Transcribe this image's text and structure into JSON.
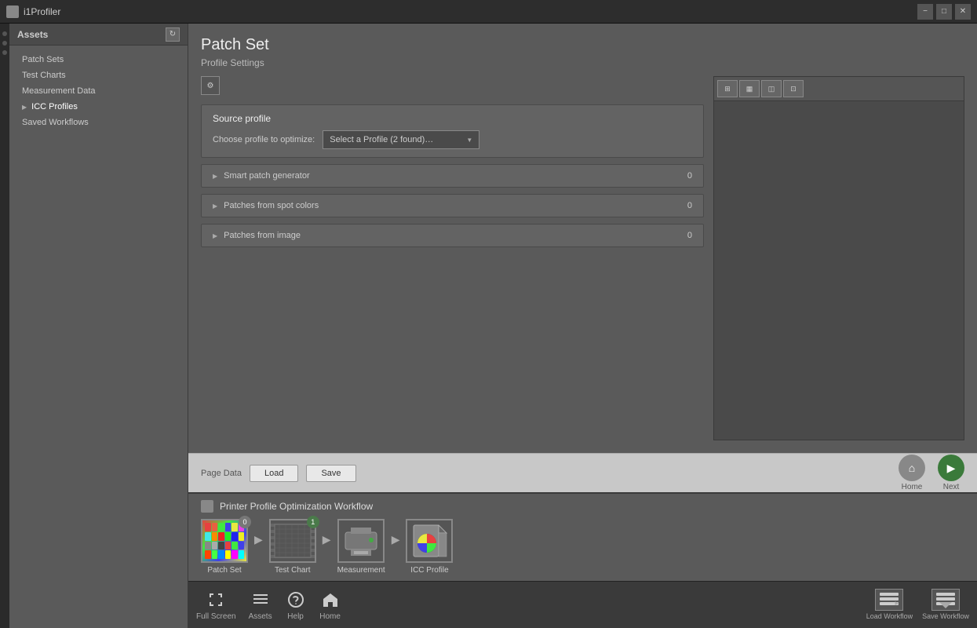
{
  "app": {
    "title": "i1Profiler",
    "icon": "profiler-icon"
  },
  "titlebar": {
    "minimize_label": "−",
    "maximize_label": "□",
    "close_label": "✕"
  },
  "sidebar": {
    "header_label": "Assets",
    "refresh_label": "↻",
    "items": [
      {
        "id": "patch-sets",
        "label": "Patch Sets",
        "arrow": false
      },
      {
        "id": "test-charts",
        "label": "Test Charts",
        "arrow": false
      },
      {
        "id": "measurement-data",
        "label": "Measurement Data",
        "arrow": false
      },
      {
        "id": "icc-profiles",
        "label": "ICC Profiles",
        "arrow": true
      },
      {
        "id": "saved-workflows",
        "label": "Saved Workflows",
        "arrow": false
      }
    ]
  },
  "patch_set": {
    "title": "Patch Set",
    "subtitle": "Profile Settings",
    "source_profile": {
      "label": "Source profile",
      "choose_label": "Choose profile to optimize:",
      "dropdown_value": "Select a Profile (2 found)…"
    },
    "sections": [
      {
        "id": "smart-patch-generator",
        "label": "Smart patch generator",
        "count": "0"
      },
      {
        "id": "patches-from-spot-colors",
        "label": "Patches from spot colors",
        "count": "0"
      },
      {
        "id": "patches-from-image",
        "label": "Patches from image",
        "count": "0"
      }
    ],
    "right_toolbar_buttons": [
      "⊞",
      "▦",
      "◫",
      "⊡"
    ]
  },
  "page_data": {
    "label": "Page Data",
    "load_label": "Load",
    "save_label": "Save"
  },
  "navigation": {
    "home_label": "Home",
    "next_label": "Next"
  },
  "workflow": {
    "icon": "workflow-icon",
    "title": "Printer Profile Optimization Workflow",
    "steps": [
      {
        "id": "patch-set",
        "label": "Patch Set",
        "badge": "0",
        "active": false
      },
      {
        "id": "test-chart",
        "label": "Test Chart",
        "badge": "1",
        "active": true
      },
      {
        "id": "measurement",
        "label": "Measurement",
        "badge": "",
        "active": false
      },
      {
        "id": "icc-profile",
        "label": "ICC Profile",
        "badge": "",
        "active": false
      }
    ]
  },
  "bottom_toolbar": {
    "tools": [
      {
        "id": "full-screen",
        "icon": "⛶",
        "label": "Full Screen"
      },
      {
        "id": "assets",
        "icon": "≡",
        "label": "Assets"
      },
      {
        "id": "help",
        "icon": "?",
        "label": "Help"
      },
      {
        "id": "home",
        "icon": "⌂",
        "label": "Home"
      }
    ],
    "workflow_actions": [
      {
        "id": "load-workflow",
        "icon": "⬆",
        "label": "Load Workflow"
      },
      {
        "id": "save-workflow",
        "icon": "⬇",
        "label": "Save Workflow"
      }
    ]
  },
  "colors": {
    "accent_green": "#3a7a3a",
    "bg_dark": "#3a3a3a",
    "bg_mid": "#5a5a5a",
    "sidebar_bg": "#5a5a5a",
    "text_light": "#eee",
    "text_mid": "#ccc"
  }
}
